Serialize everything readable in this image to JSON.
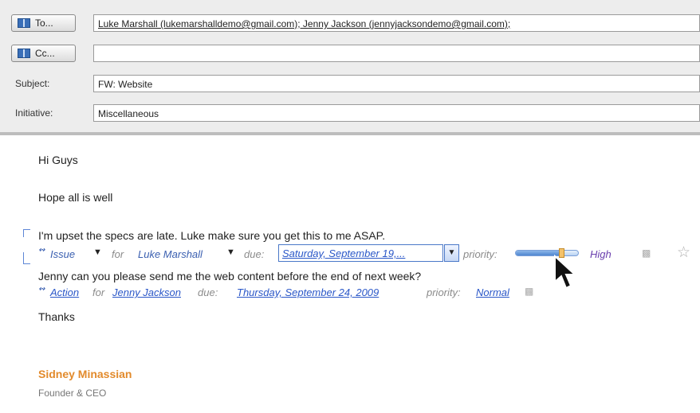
{
  "header": {
    "to_button": "To...",
    "cc_button": "Cc...",
    "to_value": "Luke Marshall (lukemarshalldemo@gmail.com); Jenny Jackson (jennyjacksondemo@gmail.com);",
    "cc_value": "",
    "subject_label": "Subject:",
    "subject_value": "FW: Website",
    "initiative_label": "Initiative:",
    "initiative_value": "Miscellaneous"
  },
  "body": {
    "greeting": "Hi Guys",
    "line1": "Hope all is well",
    "task1_text": "I'm upset the specs are late. Luke make sure you get this to me ASAP.",
    "task1": {
      "type": "Issue",
      "for_label": "for",
      "assignee": "Luke Marshall",
      "due_label": "due:",
      "due_value": "Saturday, September 19,...",
      "priority_label": "priority:",
      "priority_value": "High",
      "priority_level": 0.75
    },
    "task2_text": "Jenny can you please send me the web content before the end of next week?",
    "task2": {
      "type": "Action",
      "for_label": "for",
      "assignee": "Jenny Jackson",
      "due_label": "due:",
      "due_value": "Thursday, September 24, 2009",
      "priority_label": "priority:",
      "priority_value": "Normal"
    },
    "closing": "Thanks"
  },
  "signature": {
    "name": "Sidney Minassian",
    "title": "Founder & CEO"
  },
  "colors": {
    "accent": "#3a5fb0",
    "signature": "#e28a2b"
  }
}
